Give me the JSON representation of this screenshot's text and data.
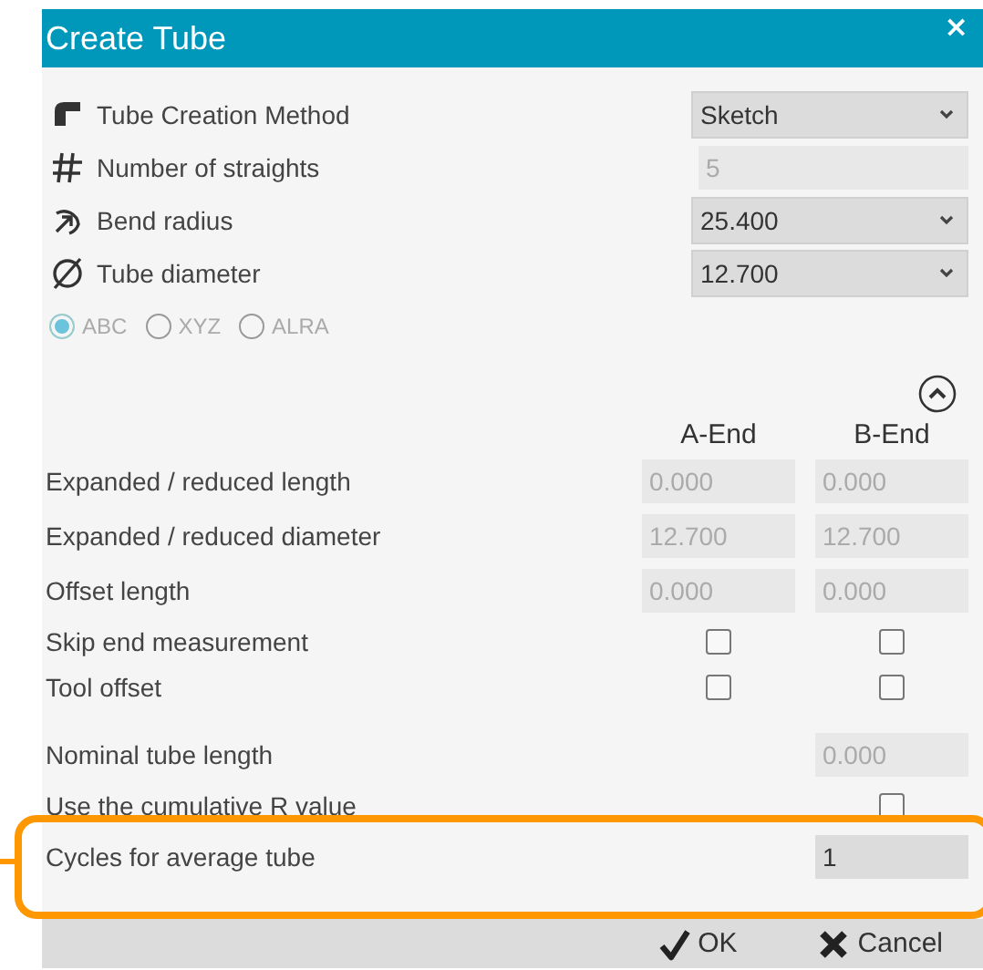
{
  "window": {
    "title": "Create Tube",
    "close": "×"
  },
  "settings": [
    {
      "kind": "select",
      "label": "Tube Creation Method",
      "value": "Sketch",
      "disabled": false
    },
    {
      "kind": "input",
      "label": "Number of straights",
      "value": "5",
      "disabled": true
    },
    {
      "kind": "select",
      "label": "Bend radius",
      "value": "25.400",
      "disabled": false
    },
    {
      "kind": "select",
      "label": "Tube diameter",
      "value": "12.700",
      "disabled": false
    }
  ],
  "axis_options": [
    {
      "label": "ABC",
      "selected": true,
      "disabled": true
    },
    {
      "label": "XYZ",
      "selected": false,
      "disabled": true
    },
    {
      "label": "ALRA",
      "selected": false,
      "disabled": true
    }
  ],
  "end_columns": [
    "A-End",
    "B-End"
  ],
  "end_rows": [
    {
      "kind": "input",
      "label": "Expanded / reduced length",
      "a": "0.000",
      "b": "0.000",
      "disabled": true
    },
    {
      "kind": "input",
      "label": "Expanded / reduced diameter",
      "a": "12.700",
      "b": "12.700",
      "disabled": true
    },
    {
      "kind": "input",
      "label": "Offset length",
      "a": "0.000",
      "b": "0.000",
      "disabled": true
    },
    {
      "kind": "checkbox",
      "label": "Skip end measurement",
      "a_checked": false,
      "b_checked": false
    },
    {
      "kind": "checkbox",
      "label": "Tool offset",
      "a_checked": false,
      "b_checked": false
    }
  ],
  "tube_rows": [
    {
      "kind": "input",
      "label": "Nominal tube length",
      "value": "0.000",
      "disabled": true,
      "highlighted": false
    },
    {
      "kind": "checkbox",
      "label": "Use the cumulative R value",
      "checked": false,
      "highlighted": false
    },
    {
      "kind": "input",
      "label": "Cycles for average tube",
      "value": "1",
      "disabled": false,
      "highlighted": true
    }
  ],
  "buttons": [
    {
      "kind": "ok",
      "label": "OK"
    },
    {
      "kind": "cancel",
      "label": "Cancel"
    }
  ]
}
